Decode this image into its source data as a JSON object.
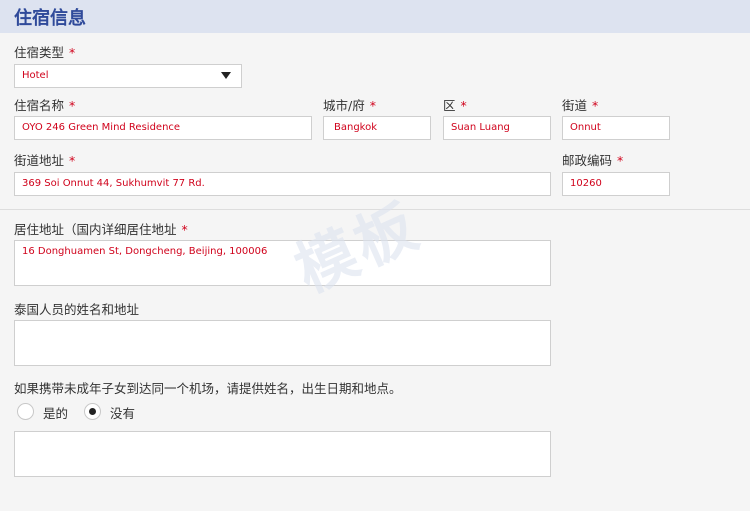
{
  "header": {
    "title": "住宿信息"
  },
  "required_mark": "*",
  "accommodation_type": {
    "label": "住宿类型",
    "value": "Hotel"
  },
  "accommodation_name": {
    "label": "住宿名称",
    "value": "OYO 246 Green Mind Residence"
  },
  "city": {
    "label": "城市/府",
    "value": "Bangkok"
  },
  "district": {
    "label": "区",
    "value": "Suan Luang"
  },
  "subdistrict": {
    "label": "街道",
    "value": "Onnut"
  },
  "street_address": {
    "label": "街道地址",
    "value": "369 Soi Onnut 44, Sukhumvit 77 Rd."
  },
  "postal_code": {
    "label": "邮政编码",
    "value": "10260"
  },
  "residential_address": {
    "label": "居住地址（国内详细居住地址",
    "value": "16 Donghuamen St, Dongcheng, Beijing, 100006"
  },
  "thai_contact": {
    "label": "泰国人员的姓名和地址",
    "value": ""
  },
  "minor_question": {
    "label": "如果携带未成年子女到达同一个机场，请提供姓名，出生日期和地点。",
    "option_yes": "是的",
    "option_no": "没有",
    "selected": "no",
    "details_value": ""
  },
  "watermark": "模板"
}
